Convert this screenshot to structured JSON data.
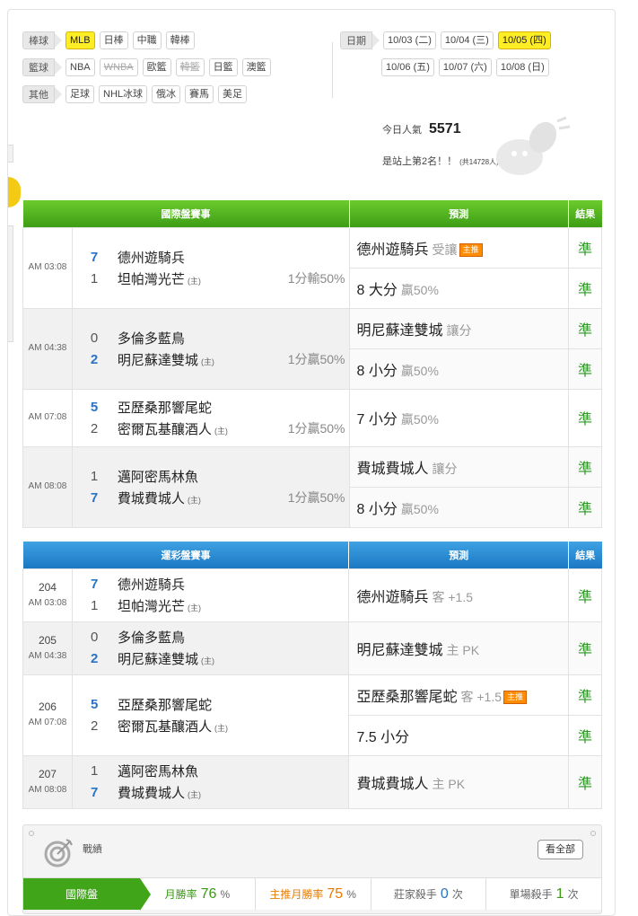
{
  "categories": [
    {
      "label": "棒球",
      "items": [
        {
          "t": "MLB",
          "s": "on"
        },
        {
          "t": "日棒"
        },
        {
          "t": "中職"
        },
        {
          "t": "韓棒"
        }
      ]
    },
    {
      "label": "籃球",
      "items": [
        {
          "t": "NBA"
        },
        {
          "t": "WNBA",
          "s": "dis"
        },
        {
          "t": "歐籃"
        },
        {
          "t": "韓籃",
          "s": "dis"
        },
        {
          "t": "日籃"
        },
        {
          "t": "澳籃"
        }
      ]
    },
    {
      "label": "其他",
      "items": [
        {
          "t": "足球"
        },
        {
          "t": "NHL冰球"
        },
        {
          "t": "俄冰"
        },
        {
          "t": "賽馬"
        },
        {
          "t": "美足"
        }
      ]
    }
  ],
  "dates": {
    "label": "日期",
    "row1": [
      {
        "t": "10/03 (二)"
      },
      {
        "t": "10/04 (三)"
      },
      {
        "t": "10/05 (四)",
        "s": "on"
      }
    ],
    "row2": [
      {
        "t": "10/06 (五)"
      },
      {
        "t": "10/07 (六)"
      },
      {
        "t": "10/08 (日)"
      }
    ]
  },
  "popularity": {
    "label": "今日人氣",
    "value": "5571",
    "rank_text": "是站上第2名！！",
    "total": "(共14728人)"
  },
  "intl": {
    "h_event": "國際盤賽事",
    "h_pred": "預測",
    "h_result": "結果",
    "games": [
      {
        "time": "AM 03:08",
        "t1": "德州遊騎兵",
        "s1": "7",
        "t2": "坦帕灣光芒",
        "s2": "1",
        "home": "(主)",
        "odds": "1分輸50%",
        "preds": [
          {
            "main": "德州遊騎兵",
            "sub": "受讓",
            "badge": "主推",
            "r": "準"
          },
          {
            "main": "8 大分",
            "sub": "贏50%",
            "r": "準"
          }
        ]
      },
      {
        "time": "AM 04:38",
        "t1": "多倫多藍鳥",
        "s1": "0",
        "t2": "明尼蘇達雙城",
        "s2": "2",
        "home": "(主)",
        "odds": "1分贏50%",
        "preds": [
          {
            "main": "明尼蘇達雙城",
            "sub": "讓分",
            "r": "準"
          },
          {
            "main": "8 小分",
            "sub": "贏50%",
            "r": "準"
          }
        ]
      },
      {
        "time": "AM 07:08",
        "t1": "亞歷桑那響尾蛇",
        "s1": "5",
        "t2": "密爾瓦基釀酒人",
        "s2": "2",
        "home": "(主)",
        "odds": "1分贏50%",
        "preds": [
          {
            "main": "7 小分",
            "sub": "贏50%",
            "r": "準"
          }
        ]
      },
      {
        "time": "AM 08:08",
        "t1": "邁阿密馬林魚",
        "s1": "1",
        "t2": "費城費城人",
        "s2": "7",
        "home": "(主)",
        "odds": "1分贏50%",
        "preds": [
          {
            "main": "費城費城人",
            "sub": "讓分",
            "r": "準"
          },
          {
            "main": "8 小分",
            "sub": "贏50%",
            "r": "準"
          }
        ]
      }
    ]
  },
  "lottery": {
    "h_event": "運彩盤賽事",
    "h_pred": "預測",
    "h_result": "結果",
    "games": [
      {
        "num": "204",
        "time": "AM 03:08",
        "t1": "德州遊騎兵",
        "s1": "7",
        "t2": "坦帕灣光芒",
        "s2": "1",
        "home": "(主)",
        "preds": [
          {
            "main": "德州遊騎兵",
            "sub": "客 +1.5",
            "r": "準"
          }
        ]
      },
      {
        "num": "205",
        "time": "AM 04:38",
        "t1": "多倫多藍鳥",
        "s1": "0",
        "t2": "明尼蘇達雙城",
        "s2": "2",
        "home": "(主)",
        "preds": [
          {
            "main": "明尼蘇達雙城",
            "sub": "主 PK",
            "r": "準"
          }
        ]
      },
      {
        "num": "206",
        "time": "AM 07:08",
        "t1": "亞歷桑那響尾蛇",
        "s1": "5",
        "t2": "密爾瓦基釀酒人",
        "s2": "2",
        "home": "(主)",
        "preds": [
          {
            "main": "亞歷桑那響尾蛇",
            "sub": "客 +1.5",
            "badge": "主推",
            "r": "準"
          },
          {
            "main": "7.5 小分",
            "sub": "",
            "r": "準"
          }
        ]
      },
      {
        "num": "207",
        "time": "AM 08:08",
        "t1": "邁阿密馬林魚",
        "s1": "1",
        "t2": "費城費城人",
        "s2": "7",
        "home": "(主)",
        "preds": [
          {
            "main": "費城費城人",
            "sub": "主 PK",
            "r": "準"
          }
        ]
      }
    ]
  },
  "stats": {
    "title": "戰績",
    "view_all": "看全部",
    "group": "國際盤",
    "items": [
      {
        "label": "月勝率",
        "value": "76",
        "unit": "%"
      },
      {
        "label": "主推月勝率",
        "value": "75",
        "unit": "%"
      },
      {
        "label": "莊家殺手",
        "value": "0",
        "unit": "次"
      },
      {
        "label": "單場殺手",
        "value": "1",
        "unit": "次"
      }
    ]
  },
  "colors": {
    "accent_yellow": "#ffed26",
    "green_header": "#3e9d15",
    "blue_header": "#1b78c2",
    "result_green": "#2b9b22",
    "score_blue": "#2a73c4",
    "badge_orange": "#ff8c00"
  }
}
